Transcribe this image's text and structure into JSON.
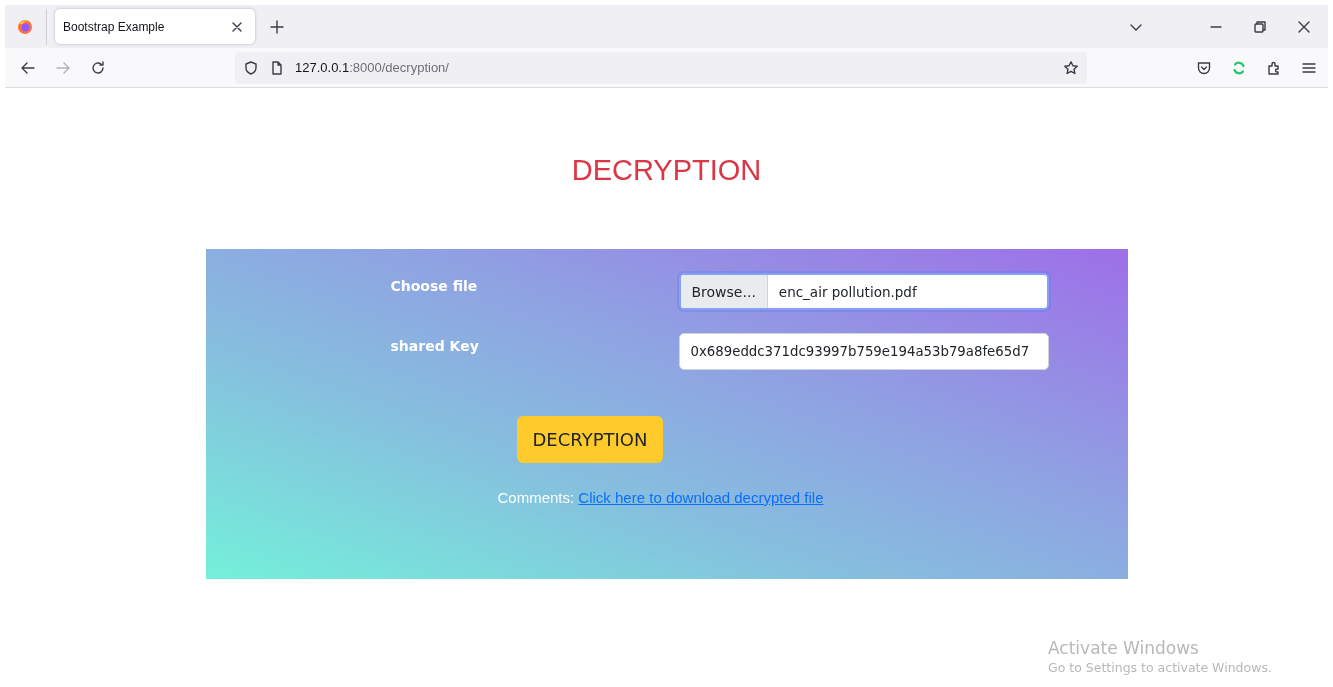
{
  "browser": {
    "tab": {
      "title": "Bootstrap Example",
      "selected": true
    },
    "address": {
      "host": "127.0.0.1",
      "path": ":8000/decryption/"
    }
  },
  "page": {
    "heading": "DECRYPTION",
    "form": {
      "fields": [
        {
          "kind": "file",
          "label": "Choose file",
          "button": "Browse...",
          "value": "enc_air pollution.pdf",
          "focused": true
        },
        {
          "kind": "text",
          "label": "shared Key",
          "value": "0x689eddc371dc93997b759e194a53b79a8fe65d7",
          "focused": false
        }
      ],
      "submit": "DECRYPTION",
      "comment_label": "Comments:",
      "link": "Click here to download decrypted file"
    }
  },
  "overlay": {
    "title": "Activate Windows",
    "subtitle": "Go to Settings to activate Windows."
  }
}
